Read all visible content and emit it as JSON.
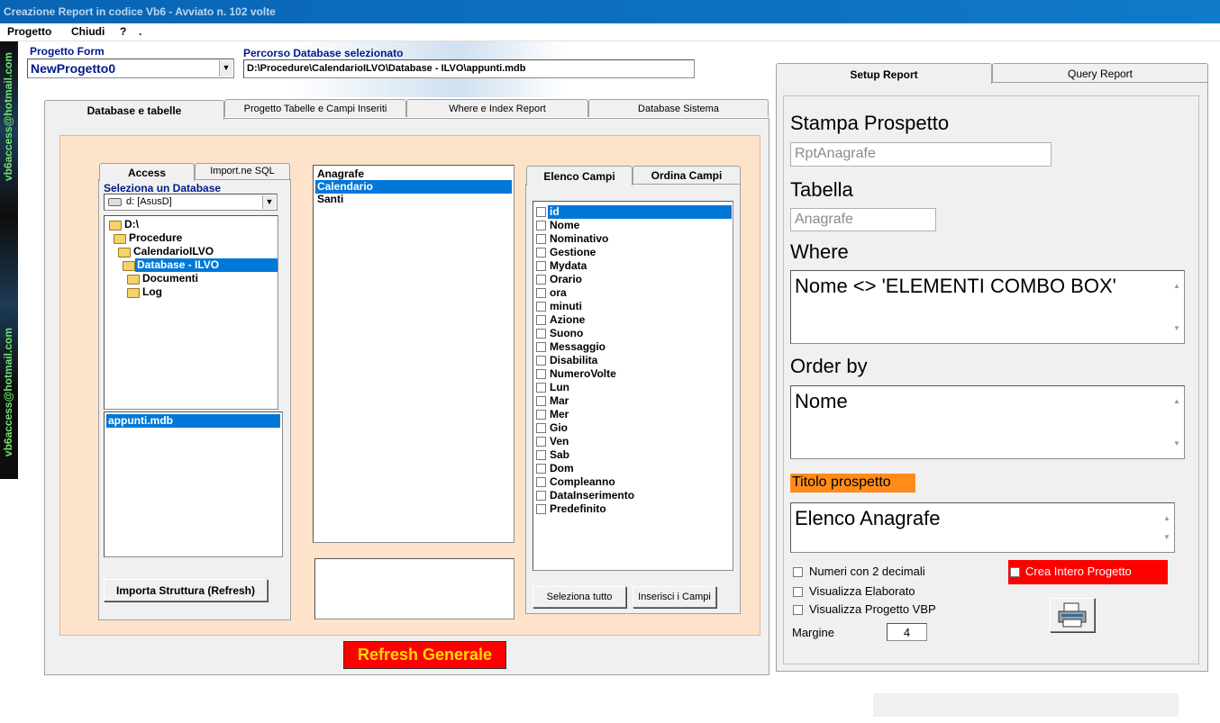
{
  "window": {
    "title": "Creazione Report in codice Vb6 - Avviato n. 102 volte"
  },
  "menu": [
    "Progetto",
    "Chiudi",
    "?",
    "."
  ],
  "side_strip": {
    "email": "vb6access@hotmail.com"
  },
  "header": {
    "form_label": "Progetto Form",
    "form_value": "NewProgetto0",
    "db_path_label": "Percorso Database selezionato",
    "db_path_value": "D:\\Procedure\\CalendarioILVO\\Database - ILVO\\appunti.mdb"
  },
  "main_tabs": [
    "Database e tabelle",
    "Progetto Tabelle e Campi Inseriti",
    "Where e Index Report",
    "Database Sistema"
  ],
  "db_panel": {
    "sub_tabs": [
      "Access",
      "Import.ne SQL"
    ],
    "select_label": "Seleziona un Database",
    "drive": "d: [AsusD]",
    "folders": [
      "D:\\",
      "Procedure",
      "CalendarioILVO",
      "Database - ILVO",
      "Documenti",
      "Log"
    ],
    "files": [
      "appunti.mdb"
    ],
    "import_button": "Importa Struttura (Refresh)"
  },
  "tables": [
    "Anagrafe",
    "Calendario",
    "Santi"
  ],
  "fields_panel": {
    "tabs": [
      "Elenco Campi",
      "Ordina Campi"
    ],
    "fields": [
      "id",
      "Nome",
      "Nominativo",
      "Gestione",
      "Mydata",
      "Orario",
      "ora",
      "minuti",
      "Azione",
      "Suono",
      "Messaggio",
      "Disabilita",
      "NumeroVolte",
      "Lun",
      "Mar",
      "Mer",
      "Gio",
      "Ven",
      "Sab",
      "Dom",
      "Compleanno",
      "DataInserimento",
      "Predefinito"
    ],
    "select_all_button": "Seleziona tutto",
    "insert_button": "Inserisci i Campi"
  },
  "refresh_button": "Refresh Generale",
  "report": {
    "tabs": [
      "Setup Report",
      "Query Report"
    ],
    "stampa_label": "Stampa Prospetto",
    "stampa_value": "RptAnagrafe",
    "tabella_label": "Tabella",
    "tabella_value": "Anagrafe",
    "where_label": "Where",
    "where_value": "Nome <> 'ELEMENTI COMBO BOX'",
    "order_label": "Order by",
    "order_value": "Nome",
    "titolo_label": "Titolo prospetto",
    "titolo_value": "Elenco Anagrafe",
    "options": [
      "Numeri con 2 decimali",
      "Visualizza Elaborato",
      "Visualizza Progetto VBP"
    ],
    "crea_label": "Crea Intero Progetto",
    "margine_label": "Margine",
    "margine_value": "4"
  },
  "colors": {
    "accent_red": "#ff0000",
    "refresh_text": "#ffdd00",
    "orange_label": "#ff8c1a",
    "peach": "#fde3c9",
    "selection": "#0078d7"
  }
}
